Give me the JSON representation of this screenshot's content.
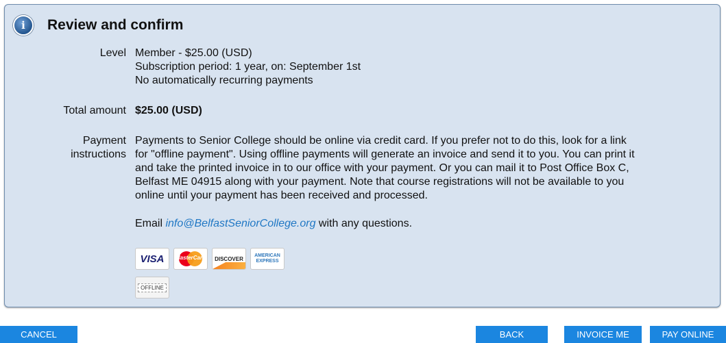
{
  "header": {
    "title": "Review and confirm"
  },
  "level": {
    "label": "Level",
    "lines": [
      "Member - $25.00 (USD)",
      "Subscription period: 1 year, on: September 1st",
      "No automatically recurring payments"
    ]
  },
  "total": {
    "label": "Total amount",
    "value": "$25.00 (USD)"
  },
  "payment": {
    "label_line1": "Payment",
    "label_line2": "instructions",
    "lines": [
      "Payments to Senior College should be online via credit card. If you prefer not to do this, look for a link",
      "for \"offline payment\". Using offline payments will generate an invoice and send it to you. You can print it",
      "and take the printed invoice in to our office with your payment. Or you can mail it to Post Office Box C,",
      "Belfast ME 04915 along with your payment. Note that course registrations will not be available to you",
      "online until your payment has been received and processed."
    ],
    "email_prefix": "Email ",
    "email": "info@BelfastSeniorCollege.org",
    "email_suffix": " with any questions."
  },
  "cards": {
    "visa": "VISA",
    "mastercard": "MasterCard",
    "discover": "DISCOVER",
    "amex_line1": "AMERICAN",
    "amex_line2": "EXPRESS",
    "offline": "OFFLINE"
  },
  "buttons": {
    "cancel": "CANCEL",
    "back": "BACK",
    "invoice": "INVOICE ME",
    "pay": "PAY ONLINE"
  },
  "colors": {
    "button": "#1b86e0",
    "panel": "#d8e3f0",
    "link": "#1f77c4"
  }
}
